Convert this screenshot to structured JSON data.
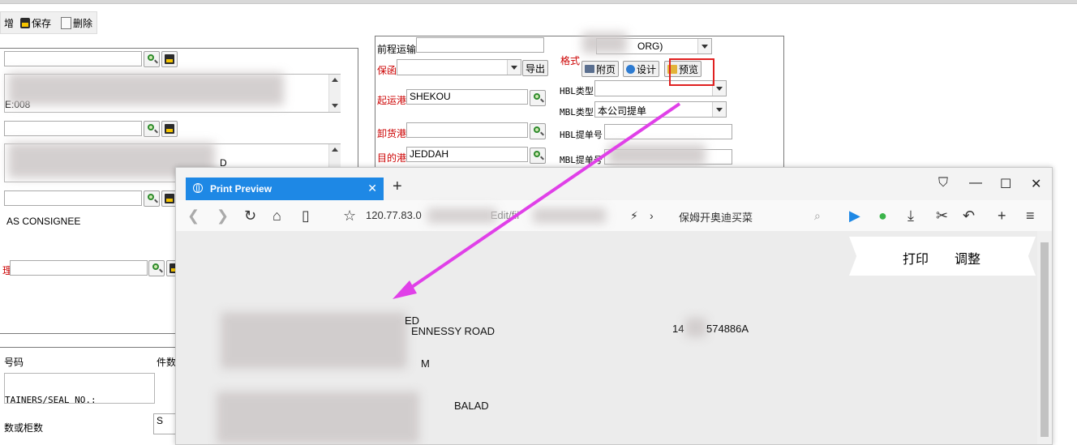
{
  "toolbar": {
    "add_label": "增",
    "save_label": "保存",
    "delete_label": "删除"
  },
  "left": {
    "shipper_partial": "E:008",
    "consignee_text": "AS CONSIGNEE",
    "agent_label_partial": "理",
    "container_label_partial": "号码",
    "pieces_label": "件数",
    "containers_seal_partial": "TAINERS/SEAL NO.:",
    "pkgs_label_partial": "数或柜数",
    "notify_partial": "D",
    "pkgs_value_partial": "S"
  },
  "middle": {
    "pre_carriage_label": "前程运输",
    "guarantee_label": "保函",
    "export_button": "导出",
    "pol_label": "起运港",
    "pol_value": "SHEKOU",
    "pod_label": "卸货港",
    "dest_label": "目的港",
    "dest_value": "JEDDAH"
  },
  "right": {
    "format_label": "格式",
    "format_value": "ORG)",
    "attach_button": "附页",
    "design_button": "设计",
    "preview_button": "预览",
    "hbl_type_label": "HBL类型",
    "mbl_type_label": "MBL类型",
    "mbl_type_value": "本公司提单",
    "hbl_no_label": "HBL提单号",
    "mbl_no_label": "MBL提单号"
  },
  "browser": {
    "tab_title": "Print Preview",
    "url_host": "120.77.83.0",
    "url_path": "Edit/fil",
    "search_text": "保姆开奥迪买菜",
    "print_button": "打印",
    "adjust_button": "调整",
    "doc_lines": {
      "l1": "ED",
      "l2": "ENNESSY ROAD",
      "l3": "M",
      "l4": "BALAD",
      "id": "14",
      "id_tail": "574886A"
    }
  },
  "annotation": {
    "box_color": "#e02020",
    "arrow_color": "#e040e8"
  }
}
